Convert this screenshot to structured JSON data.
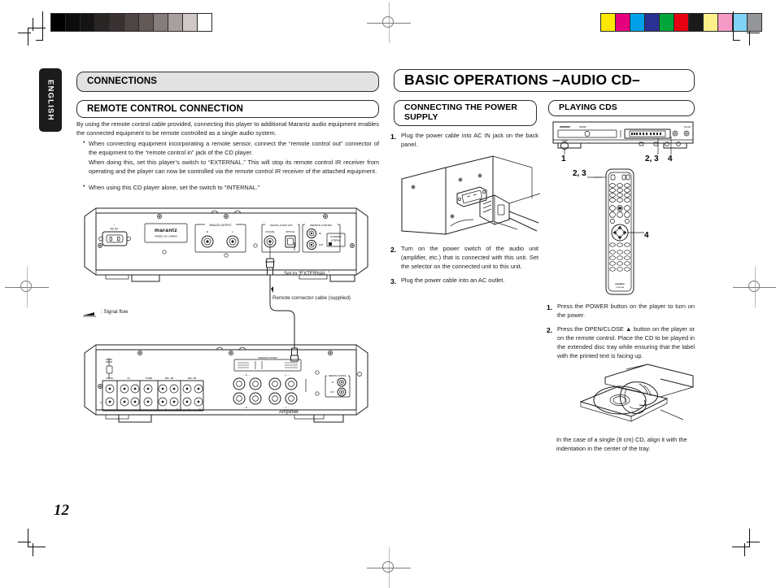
{
  "page": {
    "number": "12",
    "language_tab": "ENGLISH"
  },
  "left_column": {
    "section_heading": "CONNECTIONS",
    "subsection_heading": "REMOTE CONTROL CONNECTION",
    "intro": "By using the remote control cable provided, connecting this player to additional Marantz audio equipment enables the connected equipment to be remote controlled as a single audio system.",
    "bullets": [
      {
        "text": "When connecting equipment incorporating a remote sensor, connect the “remote control out” connector of the equipment to the “remote control in” jack of the CD player.",
        "continuation": "When doing this, set this player’s switch to “EXTERNAL.” This will stop its remote control IR receiver from operating and the player can now be controlled via the remote control IR receiver of the attached equipment."
      },
      {
        "text": "When using this CD player alone, set the switch to “INTERNAL.”",
        "continuation": ""
      }
    ],
    "diagram_labels": {
      "set_external": "Set to “EXTERNAL.”",
      "remote_cable": "Remote connector cable (supplied)",
      "signal_flow": ": Signal flow",
      "amplifier": "Amplifier"
    },
    "cd_rear_panel": {
      "ac_in": "AC IN",
      "brand": "marantz",
      "model": "MODEL NO. SA8400",
      "analog_output": "ANALOG OUTPUT",
      "analog_r": "R",
      "analog_l": "L",
      "digital_out": "DIGITAL AUDIO OUT",
      "coaxial": "COAXIAL",
      "optical": "OPTICAL",
      "remote_control": "REMOTE CONTROL",
      "remote_in": "IN",
      "remote_out": "OUT",
      "switch_external": "EXTERNAL",
      "switch_internal": "INTERNAL"
    }
  },
  "middle_column": {
    "main_heading": "BASIC OPERATIONS  –AUDIO CD–",
    "subsection_heading": "CONNECTING THE POWER SUPPLY",
    "steps": [
      {
        "n": "1.",
        "text": "Plug the power cable into AC IN jack on the back panel."
      },
      {
        "n": "2.",
        "text": "Turn on the power switch of the audio unit (amplifier, etc.) that is connected with this unit. Set the selector on the connected unit to this unit."
      },
      {
        "n": "3.",
        "text": "Plug the power cable into an AC outlet."
      }
    ]
  },
  "right_column": {
    "subsection_heading": "PLAYING CDS",
    "steps": [
      {
        "n": "1.",
        "text": "Press the POWER button on the player to turn on the power."
      },
      {
        "n": "2.",
        "text": "Press the OPEN/CLOSE ▲ button on the player or on the remote control. Place the CD to be played in the extended disc tray while ensuring that the label with the printed text is facing up."
      }
    ],
    "note": "In the case of a single (8 cm) CD, align it with the indentation in the center of the tray.",
    "callouts": {
      "front_power": "1",
      "front_openclose": "2, 3",
      "front_play": "4",
      "remote_top": "2, 3",
      "remote_nav": "4"
    },
    "front_panel": {
      "brand": "marantz",
      "model": "SA8400",
      "power_label": "POWER",
      "right_mark": "SA-CD"
    }
  },
  "print_marks": {
    "grayscale_patches": [
      "#000000",
      "#0d0b0b",
      "#161313",
      "#2a2525",
      "#3a3232",
      "#4d4543",
      "#635a57",
      "#867d7a",
      "#a9a09d",
      "#cfc8c6",
      "#ffffff"
    ],
    "color_patches": [
      "#ffe800",
      "#e5007e",
      "#00a0e9",
      "#2a3192",
      "#00a63c",
      "#e60012",
      "#1a1a1a",
      "#fdf08a",
      "#f59ac5",
      "#81d3f5",
      "#939598"
    ]
  }
}
